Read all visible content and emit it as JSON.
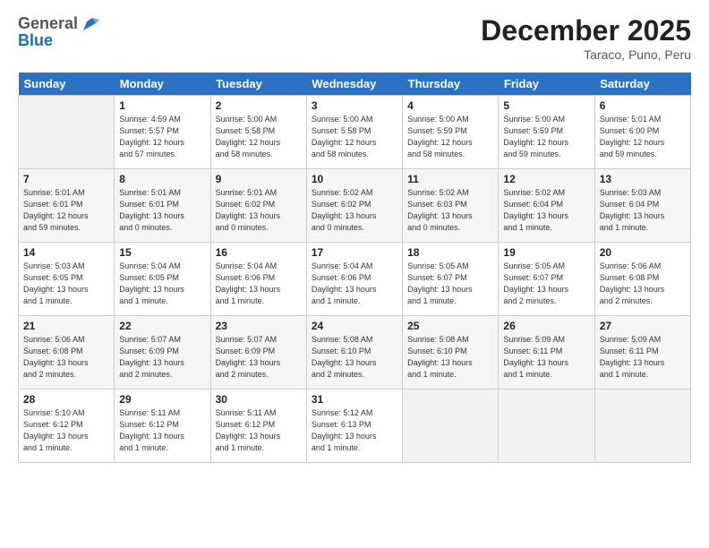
{
  "header": {
    "logo_general": "General",
    "logo_blue": "Blue",
    "title": "December 2025",
    "subtitle": "Taraco, Puno, Peru"
  },
  "days_of_week": [
    "Sunday",
    "Monday",
    "Tuesday",
    "Wednesday",
    "Thursday",
    "Friday",
    "Saturday"
  ],
  "weeks": [
    [
      {
        "day": "",
        "info": ""
      },
      {
        "day": "1",
        "info": "Sunrise: 4:59 AM\nSunset: 5:57 PM\nDaylight: 12 hours\nand 57 minutes."
      },
      {
        "day": "2",
        "info": "Sunrise: 5:00 AM\nSunset: 5:58 PM\nDaylight: 12 hours\nand 58 minutes."
      },
      {
        "day": "3",
        "info": "Sunrise: 5:00 AM\nSunset: 5:58 PM\nDaylight: 12 hours\nand 58 minutes."
      },
      {
        "day": "4",
        "info": "Sunrise: 5:00 AM\nSunset: 5:59 PM\nDaylight: 12 hours\nand 58 minutes."
      },
      {
        "day": "5",
        "info": "Sunrise: 5:00 AM\nSunset: 5:59 PM\nDaylight: 12 hours\nand 59 minutes."
      },
      {
        "day": "6",
        "info": "Sunrise: 5:01 AM\nSunset: 6:00 PM\nDaylight: 12 hours\nand 59 minutes."
      }
    ],
    [
      {
        "day": "7",
        "info": "Sunrise: 5:01 AM\nSunset: 6:01 PM\nDaylight: 12 hours\nand 59 minutes."
      },
      {
        "day": "8",
        "info": "Sunrise: 5:01 AM\nSunset: 6:01 PM\nDaylight: 13 hours\nand 0 minutes."
      },
      {
        "day": "9",
        "info": "Sunrise: 5:01 AM\nSunset: 6:02 PM\nDaylight: 13 hours\nand 0 minutes."
      },
      {
        "day": "10",
        "info": "Sunrise: 5:02 AM\nSunset: 6:02 PM\nDaylight: 13 hours\nand 0 minutes."
      },
      {
        "day": "11",
        "info": "Sunrise: 5:02 AM\nSunset: 6:03 PM\nDaylight: 13 hours\nand 0 minutes."
      },
      {
        "day": "12",
        "info": "Sunrise: 5:02 AM\nSunset: 6:04 PM\nDaylight: 13 hours\nand 1 minute."
      },
      {
        "day": "13",
        "info": "Sunrise: 5:03 AM\nSunset: 6:04 PM\nDaylight: 13 hours\nand 1 minute."
      }
    ],
    [
      {
        "day": "14",
        "info": "Sunrise: 5:03 AM\nSunset: 6:05 PM\nDaylight: 13 hours\nand 1 minute."
      },
      {
        "day": "15",
        "info": "Sunrise: 5:04 AM\nSunset: 6:05 PM\nDaylight: 13 hours\nand 1 minute."
      },
      {
        "day": "16",
        "info": "Sunrise: 5:04 AM\nSunset: 6:06 PM\nDaylight: 13 hours\nand 1 minute."
      },
      {
        "day": "17",
        "info": "Sunrise: 5:04 AM\nSunset: 6:06 PM\nDaylight: 13 hours\nand 1 minute."
      },
      {
        "day": "18",
        "info": "Sunrise: 5:05 AM\nSunset: 6:07 PM\nDaylight: 13 hours\nand 1 minute."
      },
      {
        "day": "19",
        "info": "Sunrise: 5:05 AM\nSunset: 6:07 PM\nDaylight: 13 hours\nand 2 minutes."
      },
      {
        "day": "20",
        "info": "Sunrise: 5:06 AM\nSunset: 6:08 PM\nDaylight: 13 hours\nand 2 minutes."
      }
    ],
    [
      {
        "day": "21",
        "info": "Sunrise: 5:06 AM\nSunset: 6:08 PM\nDaylight: 13 hours\nand 2 minutes."
      },
      {
        "day": "22",
        "info": "Sunrise: 5:07 AM\nSunset: 6:09 PM\nDaylight: 13 hours\nand 2 minutes."
      },
      {
        "day": "23",
        "info": "Sunrise: 5:07 AM\nSunset: 6:09 PM\nDaylight: 13 hours\nand 2 minutes."
      },
      {
        "day": "24",
        "info": "Sunrise: 5:08 AM\nSunset: 6:10 PM\nDaylight: 13 hours\nand 2 minutes."
      },
      {
        "day": "25",
        "info": "Sunrise: 5:08 AM\nSunset: 6:10 PM\nDaylight: 13 hours\nand 1 minute."
      },
      {
        "day": "26",
        "info": "Sunrise: 5:09 AM\nSunset: 6:11 PM\nDaylight: 13 hours\nand 1 minute."
      },
      {
        "day": "27",
        "info": "Sunrise: 5:09 AM\nSunset: 6:11 PM\nDaylight: 13 hours\nand 1 minute."
      }
    ],
    [
      {
        "day": "28",
        "info": "Sunrise: 5:10 AM\nSunset: 6:12 PM\nDaylight: 13 hours\nand 1 minute."
      },
      {
        "day": "29",
        "info": "Sunrise: 5:11 AM\nSunset: 6:12 PM\nDaylight: 13 hours\nand 1 minute."
      },
      {
        "day": "30",
        "info": "Sunrise: 5:11 AM\nSunset: 6:12 PM\nDaylight: 13 hours\nand 1 minute."
      },
      {
        "day": "31",
        "info": "Sunrise: 5:12 AM\nSunset: 6:13 PM\nDaylight: 13 hours\nand 1 minute."
      },
      {
        "day": "",
        "info": ""
      },
      {
        "day": "",
        "info": ""
      },
      {
        "day": "",
        "info": ""
      }
    ]
  ]
}
